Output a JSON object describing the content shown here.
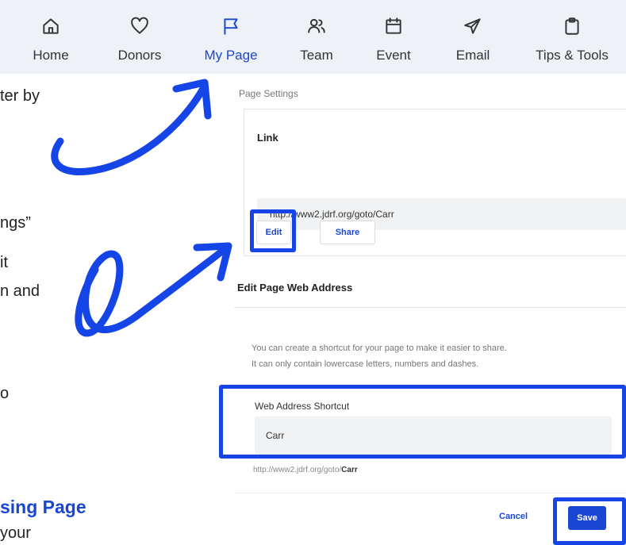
{
  "nav": {
    "items": [
      {
        "label": "Home",
        "icon": "home-icon",
        "active": false
      },
      {
        "label": "Donors",
        "icon": "heart-icon",
        "active": false
      },
      {
        "label": "My Page",
        "icon": "flag-icon",
        "active": true
      },
      {
        "label": "Team",
        "icon": "people-icon",
        "active": false
      },
      {
        "label": "Event",
        "icon": "calendar-icon",
        "active": false
      },
      {
        "label": "Email",
        "icon": "send-icon",
        "active": false
      },
      {
        "label": "Tips & Tools",
        "icon": "clipboard-icon",
        "active": false
      }
    ]
  },
  "left_text": {
    "line1": "ter by",
    "line2": "ngs”",
    "line3": "it",
    "line4": "n and",
    "line5": "o",
    "heading": "sing Page",
    "line6": "your"
  },
  "settings": {
    "title": "Page Settings",
    "link_label": "Link",
    "url": "http://www2.jdrf.org/goto/Carr",
    "edit_label": "Edit",
    "share_label": "Share",
    "section_title": "Edit Page Web Address",
    "help_line1": "You can create a shortcut for your page to make it easier to share.",
    "help_line2": "It can only contain lowercase letters, numbers and dashes.",
    "field_label": "Web Address Shortcut",
    "field_value": "Carr",
    "preview_prefix": "http://www2.jdrf.org/goto/",
    "preview_bold": "Carr",
    "cancel_label": "Cancel",
    "save_label": "Save"
  },
  "colors": {
    "accent": "#1a46d4",
    "annotation": "#1545e6",
    "nav_bg": "#eef2f6"
  }
}
